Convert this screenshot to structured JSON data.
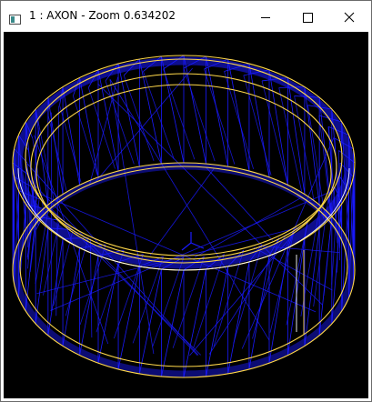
{
  "window": {
    "title": "1 : AXON - Zoom 0.634202",
    "controls": [
      "minimize-icon",
      "maximize-icon",
      "close-icon"
    ]
  },
  "viewport": {
    "background": "#000000",
    "mesh_color": "#1a1aff",
    "edge_color": "#ffd84a",
    "edge_highlight": "#ffffff"
  }
}
